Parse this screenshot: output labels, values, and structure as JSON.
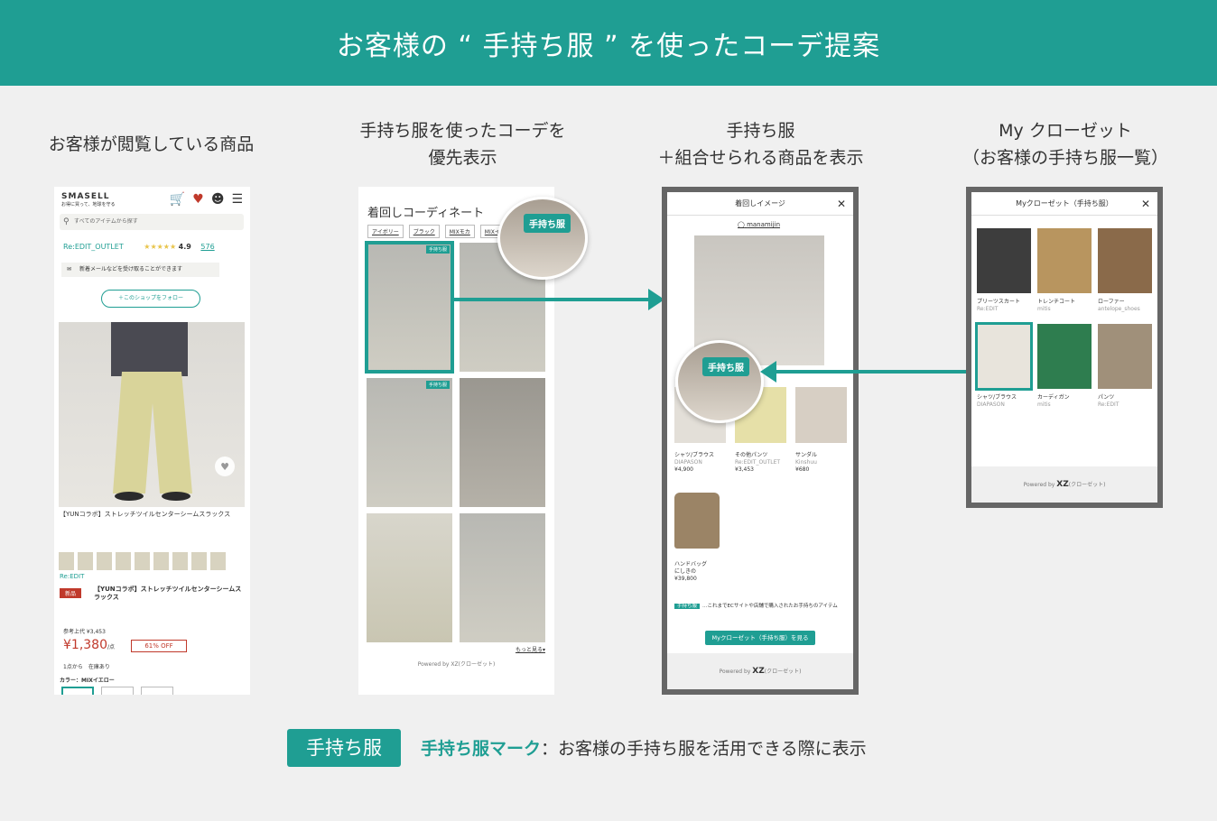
{
  "header": {
    "title": "お客様の “ 手持ち服 ” を使ったコーデ提案"
  },
  "columns": [
    {
      "title_line1": "お客様が閲覧している商品",
      "title_line2": ""
    },
    {
      "title_line1": "手持ち服を使ったコーデを",
      "title_line2": "優先表示"
    },
    {
      "title_line1": "手持ち服",
      "title_line2": "＋組合せられる商品を表示"
    },
    {
      "title_line1": "My クローゼット",
      "title_line2": "（お客様の手持ち服一覧）"
    }
  ],
  "phone1": {
    "brand": "SMASELL",
    "brand_sub": "お得に買って、地球を守る",
    "search_placeholder": "すべてのアイテムから探す",
    "shop_name": "Re:EDIT_OUTLET",
    "stars": "★★★★★",
    "rating": "4.9",
    "review_count": "576",
    "mail_text": "新着メールなどを受け取ることができます",
    "follow_label": "＋このショップをフォロー",
    "product_name": "【YUNコラボ】ストレッチツイルセンターシームスラックス",
    "shop_label": "Re:EDIT",
    "new_badge": "新品",
    "product_title": "【YUNコラボ】ストレッチツイルセンターシームスラックス",
    "ref_price": "参考上代 ¥3,453",
    "price": "¥1,380",
    "price_unit": "/点",
    "discount": "61% OFF",
    "stock": "1点から　在庫あり",
    "color_label": "カラー：MIXイエロー"
  },
  "phone2": {
    "title": "着回しコーディネート",
    "tags": [
      "アイボリー",
      "ブラック",
      "MIXモカ",
      "MIXイ"
    ],
    "badge": "手持ち服",
    "more": "もっと見る▾",
    "powered": "Powered by XZ(クローゼット)"
  },
  "mock3": {
    "title": "着回しイメージ",
    "insta": "manamijin",
    "items": [
      {
        "cat": "シャツ/ブラウス",
        "brand": "DIAPASON",
        "price": "¥4,900"
      },
      {
        "cat": "その他パンツ",
        "brand": "Re:EDIT_OUTLET",
        "price": "¥3,453"
      },
      {
        "cat": "サンダル",
        "brand": "Kinshuu",
        "price": "¥680"
      }
    ],
    "bag": {
      "cat": "ハンドバッグ",
      "brand": "にしきの",
      "price": "¥39,800"
    },
    "note_badge": "手持ち服",
    "note": "…これまでECサイトや店舗で購入されたお手持ちのアイテム",
    "button": "Myクローゼット（手持ち服）を見る",
    "powered_prefix": "Powered by",
    "powered_logo": "XZ",
    "powered_suffix": "(クローゼット)"
  },
  "mock4": {
    "title": "Myクローゼット（手持ち服）",
    "items": [
      {
        "cat": "プリーツスカート",
        "brand": "Re:EDIT"
      },
      {
        "cat": "トレンチコート",
        "brand": "mitis"
      },
      {
        "cat": "ローファー",
        "brand": "antelope_shoes"
      },
      {
        "cat": "シャツ/ブラウス",
        "brand": "DIAPASON"
      },
      {
        "cat": "カーディガン",
        "brand": "mitis"
      },
      {
        "cat": "パンツ",
        "brand": "Re:EDIT"
      }
    ],
    "powered_prefix": "Powered by",
    "powered_logo": "XZ",
    "powered_suffix": "(クローゼット)"
  },
  "bubble_badge": "手持ち服",
  "legend": {
    "badge": "手持ち服",
    "term": "手持ち服マーク",
    "desc": "：お客様の手持ち服を活用できる際に表示"
  },
  "colors": {
    "accent": "#1f9e93",
    "sale": "#c0392b",
    "background": "#f0f0f0"
  }
}
